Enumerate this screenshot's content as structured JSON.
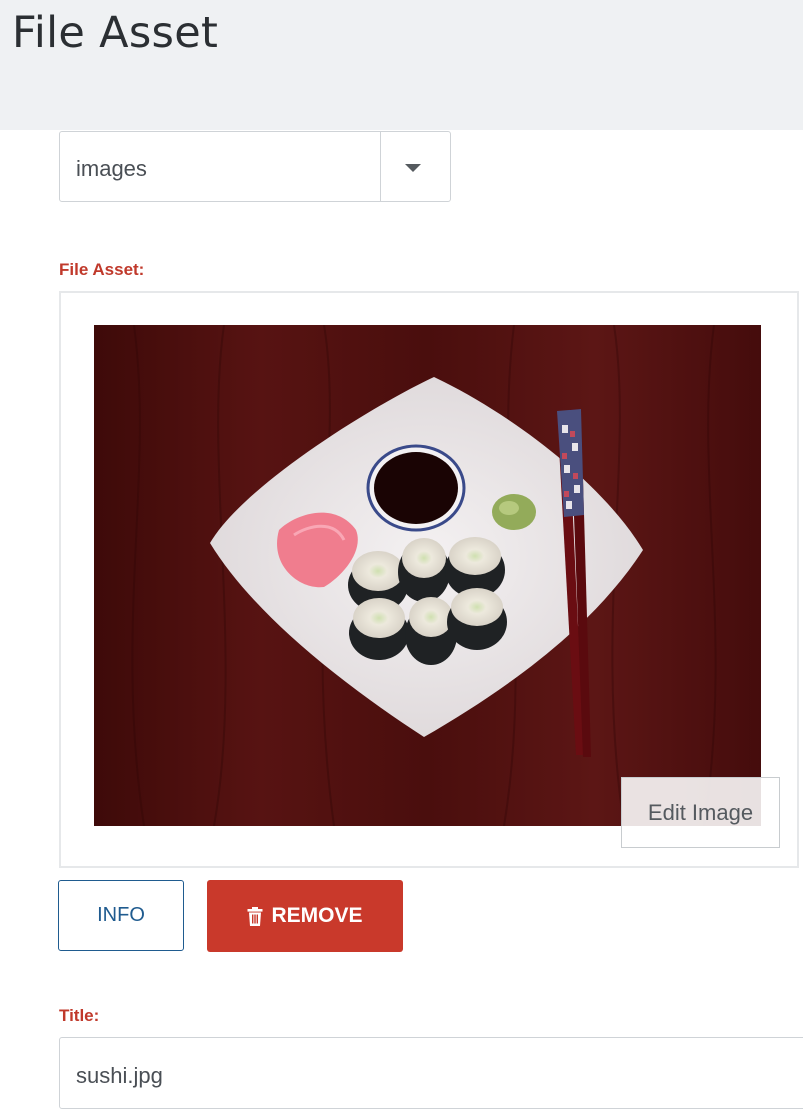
{
  "header": {
    "title": "File Asset"
  },
  "folder_select": {
    "value": "images"
  },
  "file_asset": {
    "label": "File Asset:",
    "edit_image_label": "Edit Image",
    "info_label": "INFO",
    "remove_label": "REMOVE"
  },
  "title_field": {
    "label": "Title:",
    "value": "sushi.jpg"
  },
  "icons": {
    "dropdown": "caret-down-icon",
    "remove": "trash-icon"
  },
  "colors": {
    "accent_red": "#c9392b",
    "info_blue": "#1f5b8f",
    "header_bg": "#eff1f3"
  }
}
